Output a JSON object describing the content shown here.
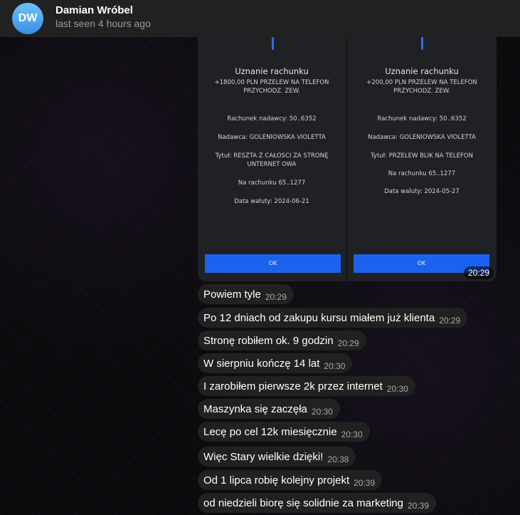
{
  "header": {
    "avatar_initials": "DW",
    "contact_name": "Damian Wróbel",
    "status": "last seen 4 hours ago"
  },
  "photo": {
    "time": "20:29",
    "left": {
      "title": "Uznanie rachunku",
      "amount": "+1800,00 PLN PRZELEW NA TELEFON",
      "category": "PRZYCHODZ. ZEW.",
      "sender_account": "Rachunek nadawcy: 50..6352",
      "sender": "Nadawca: GOLENIOWSKA VIOLETTA",
      "subject_1": "Tytuł: RESZTA Z CAŁOSCI ZA STRONĘ",
      "subject_2": "UNTERNET OWA",
      "to_account": "Na rachunku 65..1277",
      "date": "Data waluty: 2024-06-21",
      "ok": "OK"
    },
    "right": {
      "title": "Uznanie rachunku",
      "amount": "+200,00 PLN PRZELEW NA TELEFON",
      "category": "PRZYCHODZ. ZEW.",
      "sender_account": "Rachunek nadawcy: 50..6352",
      "sender": "Nadawca: GOLENIOWSKA VIOLETTA",
      "subject_1": "Tytuł: PRZELEW BLIK NA TELEFON",
      "to_account": "Na rachunku 65..1277",
      "date": "Data waluty: 2024-05-27",
      "ok": "OK"
    }
  },
  "messages": [
    {
      "text": "Powiem tyle",
      "time": "20:29"
    },
    {
      "text": "Po 12 dniach od zakupu kursu miałem już klienta",
      "time": "20:29"
    },
    {
      "text": "Stronę robiłem ok. 9 godzin",
      "time": "20:29"
    },
    {
      "text": "W sierpniu kończę 14 lat",
      "time": "20:30"
    },
    {
      "text": "I zarobiłem pierwsze 2k przez internet",
      "time": "20:30"
    },
    {
      "text": "Maszynka się zaczęła",
      "time": "20:30"
    },
    {
      "text": "Lecę po cel 12k miesięcznie",
      "time": "20:30"
    },
    {
      "text": "Więc Stary wielkie dzięki!",
      "time": "20:38"
    },
    {
      "text": "Od 1 lipca robię kolejny projekt",
      "time": "20:39"
    },
    {
      "text": "od niedzieli biorę się solidnie za marketing",
      "time": "20:39"
    }
  ]
}
